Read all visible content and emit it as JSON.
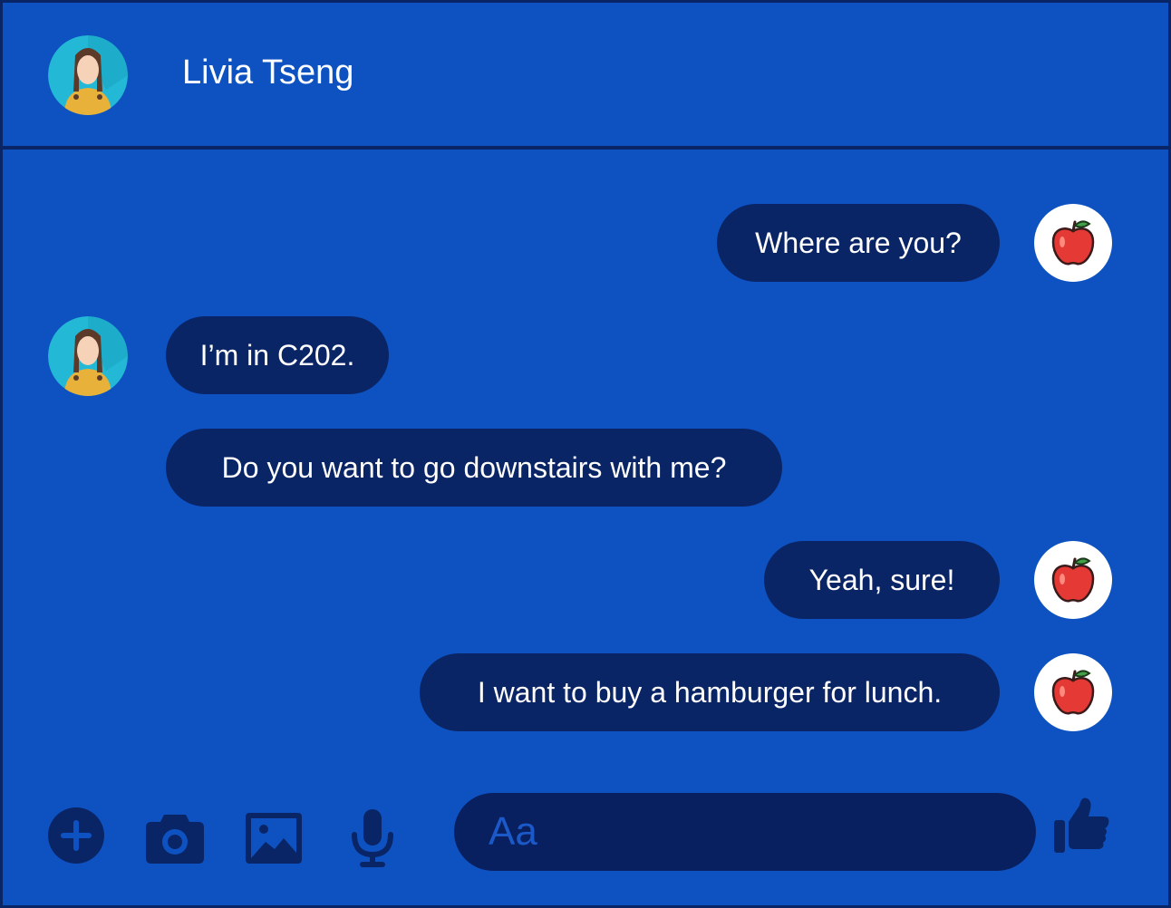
{
  "header": {
    "contact_name": "Livia Tseng",
    "contact_avatar_icon": "girl-avatar-icon"
  },
  "messages": [
    {
      "sender": "me",
      "text": "Where are you?",
      "avatar_icon": "apple-icon"
    },
    {
      "sender": "contact",
      "text": "I’m in C202.",
      "avatar_icon": "girl-avatar-icon"
    },
    {
      "sender": "contact",
      "text": "Do you want to go downstairs with me?"
    },
    {
      "sender": "me",
      "text": "Yeah, sure!",
      "avatar_icon": "apple-icon"
    },
    {
      "sender": "me",
      "text": "I want to buy a hamburger for lunch.",
      "avatar_icon": "apple-icon"
    }
  ],
  "composer": {
    "placeholder": "Aa",
    "tools": [
      "plus-icon",
      "camera-icon",
      "image-icon",
      "microphone-icon"
    ],
    "send_icon": "thumbs-up-icon"
  },
  "colors": {
    "background": "#0e52c1",
    "bubble": "#0a2566",
    "text": "#ffffff"
  }
}
